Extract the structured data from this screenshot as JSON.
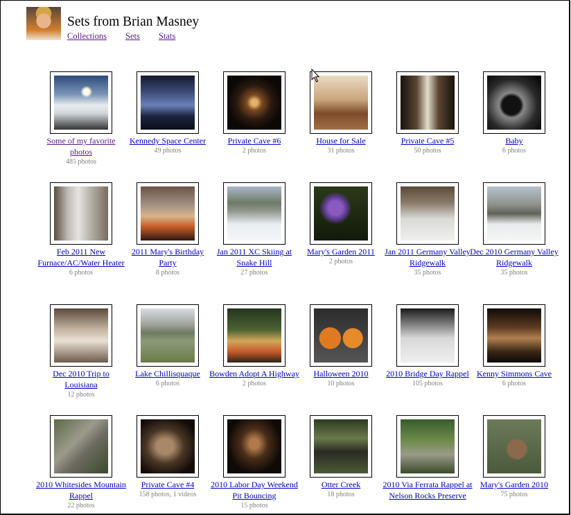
{
  "header": {
    "title": "Sets from Brian Masney",
    "nav": [
      "Collections",
      "Sets",
      "Stats"
    ]
  },
  "sets": [
    {
      "label": "Some of my favorite photos",
      "count": "485 photos",
      "thumb": "fog-sunrise",
      "visited": true
    },
    {
      "label": "Kennedy Space Center",
      "count": "49 photos",
      "thumb": "control-room"
    },
    {
      "label": "Private Cave #6",
      "count": "2 photos",
      "thumb": "cave"
    },
    {
      "label": "House for Sale",
      "count": "31 photos",
      "thumb": "living-room"
    },
    {
      "label": "Private Cave #5",
      "count": "50 photos",
      "thumb": "cave-passage"
    },
    {
      "label": "Baby",
      "count": "6 photos",
      "thumb": "ultrasound"
    },
    {
      "label": "Feb 2011 New Furnace/AC/Water Heater",
      "count": "6 photos",
      "thumb": "water-heater"
    },
    {
      "label": "2011 Mary's Birthday Party",
      "count": "8 photos",
      "thumb": "birthday-cake"
    },
    {
      "label": "Jan 2011 XC Skiing at Snake Hill",
      "count": "27 photos",
      "thumb": "snow-valley"
    },
    {
      "label": "Mary's Garden 2011",
      "count": "2 photos",
      "thumb": "crocus"
    },
    {
      "label": "Jan 2011 Germany Valley Ridgewalk",
      "count": "35 photos",
      "thumb": "snow-woods"
    },
    {
      "label": "Dec 2010 Germany Valley Ridgewalk",
      "count": "35 photos",
      "thumb": "snow-field"
    },
    {
      "label": "Dec 2010 Trip to Louisiana",
      "count": "12 photos",
      "thumb": "dollhouse"
    },
    {
      "label": "Lake Chillisquaque",
      "count": "6 photos",
      "thumb": "lake"
    },
    {
      "label": "Bowden Adopt A Highway",
      "count": "2 photos",
      "thumb": "group"
    },
    {
      "label": "Halloween 2010",
      "count": "10 photos",
      "thumb": "pumpkins"
    },
    {
      "label": "2010 Bridge Day Rappel",
      "count": "105 photos",
      "thumb": "bridge"
    },
    {
      "label": "Kenny Simmons Cave",
      "count": "6 photos",
      "thumb": "cave-formations"
    },
    {
      "label": "2010 Whitesides Mountain Rappel",
      "count": "22 photos",
      "thumb": "rock-face"
    },
    {
      "label": "Private Cave #4",
      "count": "158 photos, 1 videos",
      "thumb": "cave-room"
    },
    {
      "label": "2010 Labor Day Weekend Pit Bouncing",
      "count": "15 photos",
      "thumb": "pit"
    },
    {
      "label": "Otter Creek",
      "count": "18 photos",
      "thumb": "hiker"
    },
    {
      "label": "2010 Via Ferrata Rappel at Nelson Rocks Preserve",
      "count": "",
      "thumb": "cliff"
    },
    {
      "label": "Mary's Garden 2010",
      "count": "75 photos",
      "thumb": "groundhog"
    }
  ]
}
